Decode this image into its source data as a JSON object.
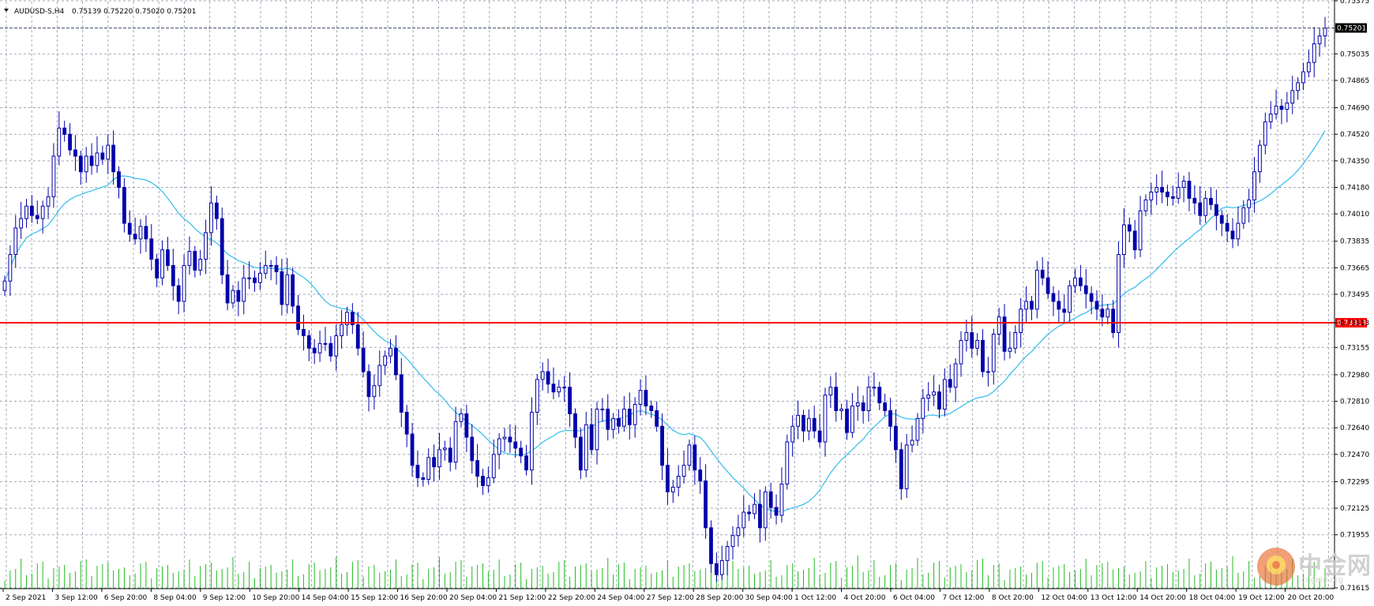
{
  "header": {
    "symbol": "AUDUSD-S,H4",
    "ohlc": "0.75139 0.75220 0.75020 0.75201"
  },
  "colors": {
    "bull": "#0000aa",
    "bear": "#0000aa",
    "ma": "#33bbee",
    "volume": "#22bb22",
    "grid": "#a0a8b8",
    "level": "#ff0000",
    "current": "#44546a"
  },
  "chart_data": {
    "type": "candlestick",
    "title": "",
    "ylim": [
      0.7161,
      0.7537
    ],
    "y_ticks": [
      "0.75375",
      "0.75035",
      "0.74865",
      "0.74690",
      "0.74520",
      "0.74350",
      "0.74180",
      "0.74010",
      "0.73835",
      "0.73665",
      "0.73495",
      "0.73313",
      "0.73155",
      "0.72980",
      "0.72810",
      "0.72640",
      "0.72470",
      "0.72295",
      "0.72125",
      "0.71955",
      "0.71615"
    ],
    "x_ticks": [
      "2 Sep 2021",
      "3 Sep 12:00",
      "6 Sep 20:00",
      "8 Sep 04:00",
      "9 Sep 12:00",
      "10 Sep 20:00",
      "14 Sep 04:00",
      "15 Sep 12:00",
      "16 Sep 20:00",
      "20 Sep 04:00",
      "21 Sep 12:00",
      "22 Sep 20:00",
      "24 Sep 04:00",
      "27 Sep 12:00",
      "28 Sep 20:00",
      "30 Sep 04:00",
      "1 Oct 12:00",
      "4 Oct 20:00",
      "6 Oct 04:00",
      "7 Oct 12:00",
      "8 Oct 20:00",
      "12 Oct 04:00",
      "13 Oct 12:00",
      "14 Oct 20:00",
      "18 Oct 04:00",
      "19 Oct 12:00",
      "20 Oct 20:00"
    ],
    "current_price": "0.75201",
    "support_level": "0.73313",
    "close": [
      0.7358,
      0.7375,
      0.7392,
      0.7398,
      0.7406,
      0.74,
      0.7398,
      0.7406,
      0.7412,
      0.7438,
      0.7456,
      0.7452,
      0.7442,
      0.7438,
      0.7428,
      0.7438,
      0.7432,
      0.744,
      0.7436,
      0.7445,
      0.7428,
      0.7418,
      0.7395,
      0.7388,
      0.7385,
      0.7393,
      0.7385,
      0.7372,
      0.736,
      0.7378,
      0.7368,
      0.7355,
      0.7345,
      0.7368,
      0.7377,
      0.7365,
      0.7372,
      0.7389,
      0.7408,
      0.7398,
      0.7362,
      0.7344,
      0.7352,
      0.7345,
      0.736,
      0.736,
      0.7357,
      0.7363,
      0.7368,
      0.7368,
      0.7364,
      0.7343,
      0.7362,
      0.7342,
      0.7327,
      0.7323,
      0.7315,
      0.7312,
      0.7318,
      0.7318,
      0.731,
      0.7323,
      0.733,
      0.7338,
      0.733,
      0.7315,
      0.73,
      0.7284,
      0.7291,
      0.7304,
      0.731,
      0.7315,
      0.7298,
      0.7274,
      0.726,
      0.724,
      0.7232,
      0.7231,
      0.7245,
      0.7239,
      0.725,
      0.7251,
      0.7242,
      0.7268,
      0.7273,
      0.7258,
      0.7243,
      0.7233,
      0.7227,
      0.7232,
      0.7247,
      0.7257,
      0.7258,
      0.7255,
      0.7251,
      0.7246,
      0.7237,
      0.7274,
      0.7295,
      0.73,
      0.7292,
      0.7287,
      0.729,
      0.729,
      0.7273,
      0.7258,
      0.7237,
      0.7266,
      0.725,
      0.7276,
      0.7276,
      0.7263,
      0.727,
      0.7265,
      0.7276,
      0.7266,
      0.7279,
      0.7288,
      0.7278,
      0.7275,
      0.7265,
      0.724,
      0.7223,
      0.7226,
      0.7233,
      0.724,
      0.7253,
      0.7237,
      0.723,
      0.72,
      0.7177,
      0.717,
      0.7179,
      0.7188,
      0.7195,
      0.72,
      0.721,
      0.7209,
      0.7215,
      0.72,
      0.7223,
      0.7213,
      0.7208,
      0.7228,
      0.7255,
      0.7265,
      0.7272,
      0.7262,
      0.727,
      0.7262,
      0.7255,
      0.7285,
      0.729,
      0.7275,
      0.7276,
      0.7261,
      0.7278,
      0.728,
      0.7275,
      0.729,
      0.729,
      0.728,
      0.7275,
      0.7265,
      0.725,
      0.7225,
      0.7253,
      0.7256,
      0.727,
      0.7283,
      0.7285,
      0.7287,
      0.7276,
      0.7295,
      0.729,
      0.7305,
      0.732,
      0.7325,
      0.7315,
      0.732,
      0.73,
      0.73,
      0.7324,
      0.7335,
      0.7313,
      0.7315,
      0.7325,
      0.734,
      0.7345,
      0.734,
      0.7365,
      0.736,
      0.735,
      0.7345,
      0.734,
      0.7338,
      0.7355,
      0.736,
      0.7355,
      0.735,
      0.7345,
      0.734,
      0.7335,
      0.734,
      0.7325,
      0.7375,
      0.7394,
      0.739,
      0.7378,
      0.7403,
      0.741,
      0.7415,
      0.7418,
      0.7415,
      0.7412,
      0.7411,
      0.7418,
      0.7422,
      0.7411,
      0.7408,
      0.74,
      0.7411,
      0.7407,
      0.74,
      0.7395,
      0.739,
      0.7385,
      0.7395,
      0.7405,
      0.741,
      0.7428,
      0.7445,
      0.746,
      0.7465,
      0.747,
      0.7468,
      0.7472,
      0.748,
      0.7485,
      0.7492,
      0.7498,
      0.751,
      0.7515,
      0.752
    ]
  }
}
